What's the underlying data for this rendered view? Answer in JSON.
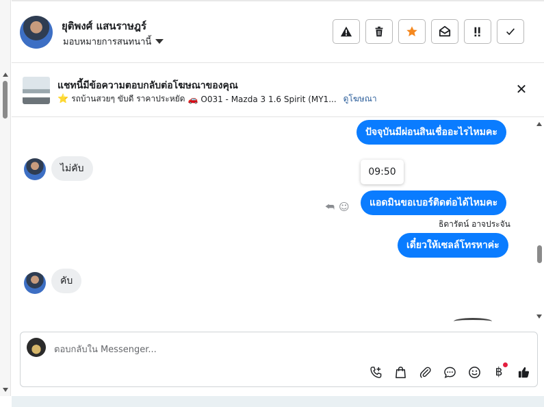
{
  "header": {
    "contact_name": "ยุติพงศ์ แสนราษฎร์",
    "assign_label": "มอบหมายการสนทนานี้",
    "actions": [
      {
        "name": "warning",
        "icon": "exclamation-triangle-icon"
      },
      {
        "name": "delete",
        "icon": "trash-icon"
      },
      {
        "name": "star",
        "icon": "star-icon",
        "color": "#f5881f"
      },
      {
        "name": "mark-unread",
        "icon": "envelope-open-icon"
      },
      {
        "name": "follow-up",
        "icon": "exclamation-double-icon"
      },
      {
        "name": "done",
        "icon": "checkmark-icon"
      }
    ]
  },
  "banner": {
    "title": "แชทนี้มีข้อความตอบกลับต่อโฆษณาของคุณ",
    "star_icon": "⭐",
    "ad_text": "รถบ้านสวยๆ ขับดี ราคาประหยัด",
    "car_icon": "🚗",
    "ad_detail": "O031 - Mazda 3 1.6 Spirit (MY1...",
    "link_label": "ดูโฆษณา"
  },
  "messages": {
    "m1": "ปัจจุบันมีผ่อนสินเชื่ออะไรไหมคะ",
    "m2": "ไม่คับ",
    "time": "09:50",
    "m3": "แอดมินขอเบอร์ติดต่อได้ไหมคะ",
    "m3_sender": "ธิดารัตน์ อาจประจัน",
    "m4": "เดี๋ยวให้เซลล์โทรหาค่ะ",
    "m5": "คับ"
  },
  "composer": {
    "placeholder": "ตอบกลับใน Messenger...",
    "tools": [
      "phone-plus-icon",
      "shopping-bag-icon",
      "paperclip-icon",
      "chat-bubble-icon",
      "smiley-icon",
      "baht-icon",
      "thumbs-up-icon"
    ],
    "baht_symbol": "฿"
  },
  "colors": {
    "outgoing_bubble": "#0a7cff",
    "incoming_bubble": "#eceef0",
    "star_accent": "#f5881f",
    "notification_dot": "#e41e3f"
  }
}
